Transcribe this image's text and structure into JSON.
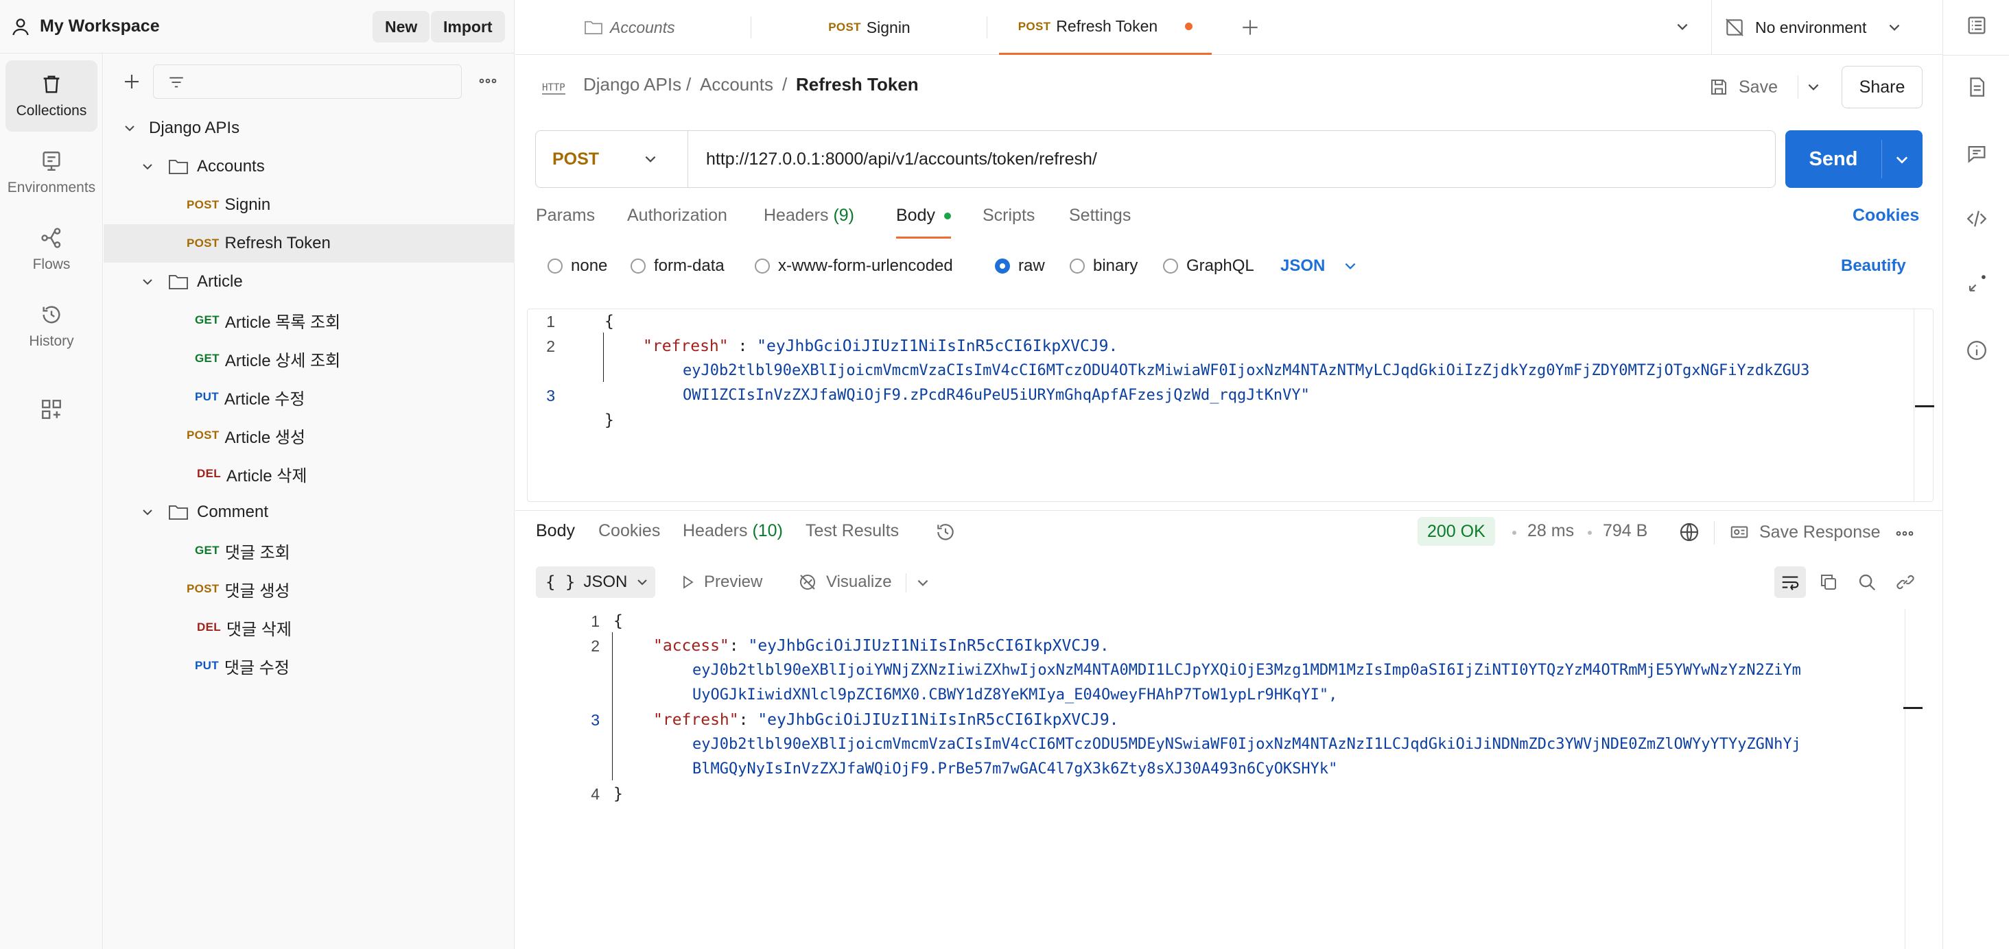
{
  "workspace": {
    "title": "My Workspace",
    "new_label": "New",
    "import_label": "Import"
  },
  "rail": [
    {
      "label": "Collections",
      "icon": "trash-bin-icon",
      "active": true
    },
    {
      "label": "Environments",
      "icon": "environment-icon",
      "active": false
    },
    {
      "label": "Flows",
      "icon": "flows-icon",
      "active": false
    },
    {
      "label": "History",
      "icon": "history-icon",
      "active": false
    }
  ],
  "tree": {
    "collection": "Django APIs",
    "folders": [
      {
        "name": "Accounts",
        "items": [
          {
            "method": "POST",
            "name": "Signin"
          },
          {
            "method": "POST",
            "name": "Refresh Token",
            "selected": true
          }
        ]
      },
      {
        "name": "Article",
        "items": [
          {
            "method": "GET",
            "name": "Article 목록 조회"
          },
          {
            "method": "GET",
            "name": "Article 상세 조회"
          },
          {
            "method": "PUT",
            "name": "Article 수정"
          },
          {
            "method": "POST",
            "name": "Article 생성"
          },
          {
            "method": "DEL",
            "name": "Article 삭제"
          }
        ]
      },
      {
        "name": "Comment",
        "items": [
          {
            "method": "GET",
            "name": "댓글 조회"
          },
          {
            "method": "POST",
            "name": "댓글 생성"
          },
          {
            "method": "DEL",
            "name": "댓글 삭제"
          },
          {
            "method": "PUT",
            "name": "댓글 수정"
          }
        ]
      }
    ]
  },
  "tabs": [
    {
      "label": "Accounts",
      "kind": "folder"
    },
    {
      "method": "POST",
      "label": "Signin"
    },
    {
      "method": "POST",
      "label": "Refresh Token",
      "active": true,
      "unsaved": true
    }
  ],
  "environment": {
    "label": "No environment"
  },
  "breadcrumb": {
    "root": "Django APIs",
    "folder": "Accounts",
    "current": "Refresh Token",
    "sep": "/"
  },
  "toolbar": {
    "save_label": "Save",
    "share_label": "Share"
  },
  "request": {
    "method": "POST",
    "url": "http://127.0.0.1:8000/api/v1/accounts/token/refresh/",
    "send_label": "Send",
    "tabs": {
      "params": "Params",
      "authorization": "Authorization",
      "headers": "Headers",
      "headers_count": "(9)",
      "body": "Body",
      "scripts": "Scripts",
      "settings": "Settings",
      "cookies": "Cookies"
    },
    "body_types": {
      "none": "none",
      "form_data": "form-data",
      "urlencoded": "x-www-form-urlencoded",
      "raw": "raw",
      "binary": "binary",
      "graphql": "GraphQL"
    },
    "selected_body_type": "raw",
    "format": "JSON",
    "beautify_label": "Beautify",
    "body_lines": {
      "l1": "{",
      "l2_key": "\"refresh\"",
      "l2_colon": " : ",
      "l2_val_a": "\"eyJhbGciOiJIUzI1NiIsInR5cCI6IkpXVCJ9.",
      "l2_val_b": "eyJ0b2tlbl90eXBlIjoicmVmcmVzaCIsImV4cCI6MTczODU4OTkzMiwiaWF0IjoxNzM4NTAzNTMyLCJqdGkiOiIzZjdkYzg0YmFjZDY0MTZjOTgxNGFiYzdkZGU3",
      "l2_val_c": "OWI1ZCIsInVzZXJfaWQiOjF9.zPcdR46uPeU5iURYmGhqApfAFzesjQzWd_rqgJtKnVY\"",
      "l3": "}"
    }
  },
  "response": {
    "tabs": {
      "body": "Body",
      "cookies": "Cookies",
      "headers": "Headers",
      "headers_count": "(10)",
      "test_results": "Test Results"
    },
    "status": "200 OK",
    "time": "28 ms",
    "size": "794 B",
    "save_response_label": "Save Response",
    "format": "JSON",
    "preview_label": "Preview",
    "visualize_label": "Visualize",
    "lines": {
      "l1": "{",
      "access_key": "\"access\"",
      "access_a": "\"eyJhbGciOiJIUzI1NiIsInR5cCI6IkpXVCJ9.",
      "access_b": "eyJ0b2tlbl90eXBlIjoiYWNjZXNzIiwiZXhwIjoxNzM4NTA0MDI1LCJpYXQiOjE3Mzg1MDM1MzIsImp0aSI6IjZiNTI0YTQzYzM4OTRmMjE5YWYwNzYzN2ZiYm",
      "access_c": "UyOGJkIiwidXNlcl9pZCI6MX0.CBWY1dZ8YeKMIya_E04OweyFHAhP7ToW1ypLr9HKqYI\",",
      "refresh_key": "\"refresh\"",
      "refresh_a": "\"eyJhbGciOiJIUzI1NiIsInR5cCI6IkpXVCJ9.",
      "refresh_b": "eyJ0b2tlbl90eXBlIjoicmVmcmVzaCIsImV4cCI6MTczODU5MDEyNSwiaWF0IjoxNzM4NTAzNzI1LCJqdGkiOiJiNDNmZDc3YWVjNDE0ZmZlOWYyYTYyZGNhYj",
      "refresh_c": "BlMGQyNyIsInVzZXJfaWQiOjF9.PrBe57m7wGAC4l7gX3k6Zty8sXJ30A493n6CyOKSHYk\"",
      "l4": "}"
    }
  },
  "line_numbers": {
    "n1": "1",
    "n2": "2",
    "n3": "3",
    "n4": "4"
  },
  "colors": {
    "accent": "#1f6fd8",
    "post": "#a56a00",
    "get": "#0b7a2a",
    "put": "#0b57c1",
    "del": "#a3201a",
    "tab_indicator": "#f06b2e",
    "ok_bg": "#e6f4ea"
  }
}
